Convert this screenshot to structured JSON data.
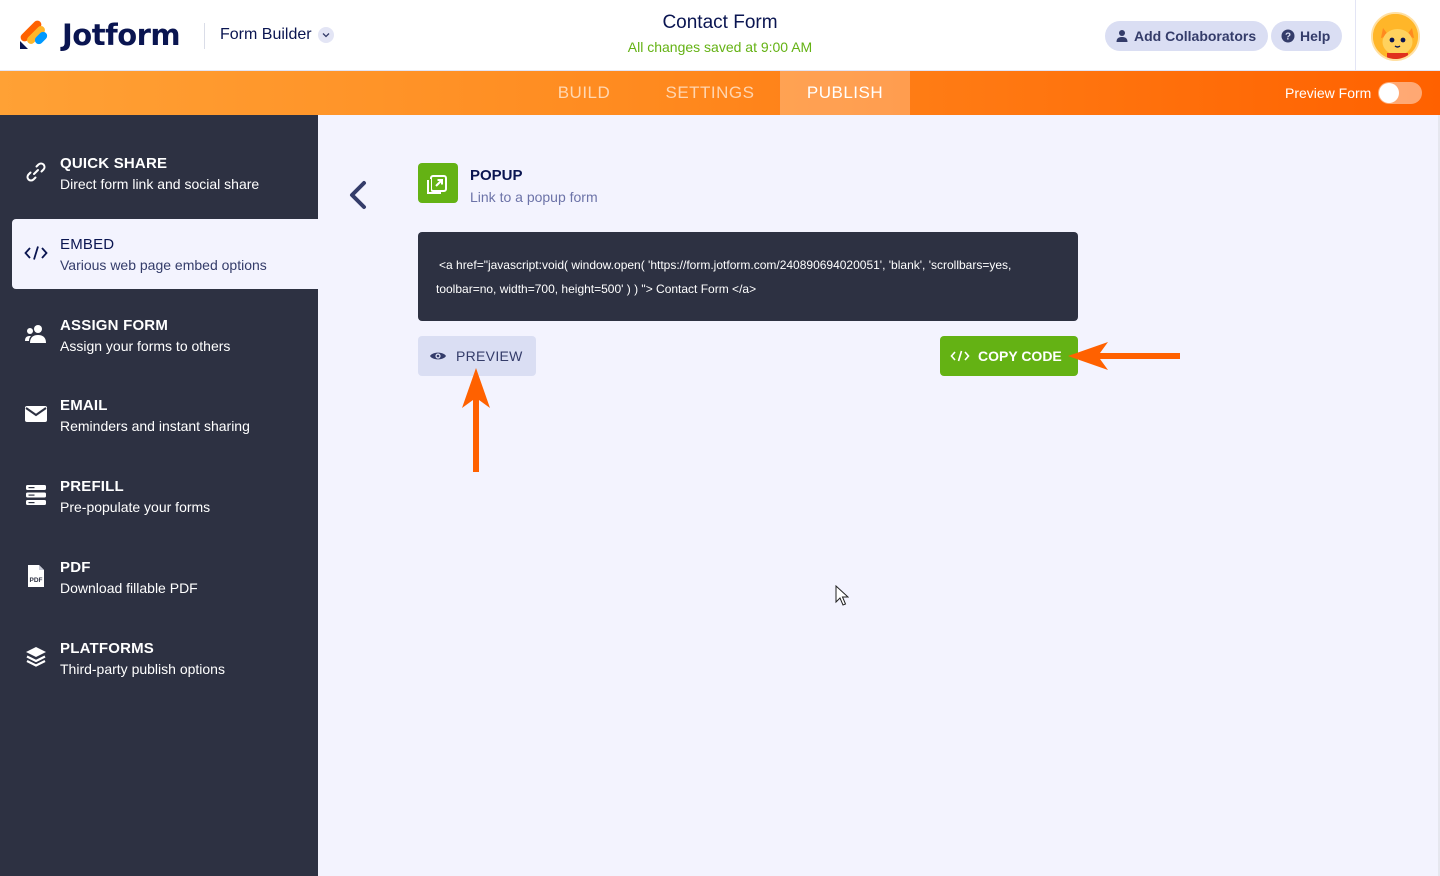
{
  "app": {
    "brand": "Jotform",
    "mode_label": "Form Builder",
    "form_title": "Contact Form",
    "save_status": "All changes saved at 9:00 AM",
    "collab_label": "Add Collaborators",
    "help_label": "Help"
  },
  "tabs": [
    {
      "label": "BUILD",
      "active": false
    },
    {
      "label": "SETTINGS",
      "active": false
    },
    {
      "label": "PUBLISH",
      "active": true
    }
  ],
  "preview_toggle": {
    "label": "Preview Form",
    "on": false
  },
  "sidebar": {
    "items": [
      {
        "title": "QUICK SHARE",
        "subtitle": "Direct form link and social share",
        "icon": "link-icon",
        "active": false
      },
      {
        "title": "EMBED",
        "subtitle": "Various web page embed options",
        "icon": "code-icon",
        "active": true
      },
      {
        "title": "ASSIGN FORM",
        "subtitle": "Assign your forms to others",
        "icon": "users-icon",
        "active": false
      },
      {
        "title": "EMAIL",
        "subtitle": "Reminders and instant sharing",
        "icon": "envelope-icon",
        "active": false
      },
      {
        "title": "PREFILL",
        "subtitle": "Pre-populate your forms",
        "icon": "prefill-icon",
        "active": false
      },
      {
        "title": "PDF",
        "subtitle": "Download fillable PDF",
        "icon": "pdf-icon",
        "active": false
      },
      {
        "title": "PLATFORMS",
        "subtitle": "Third-party publish options",
        "icon": "layers-icon",
        "active": false
      }
    ]
  },
  "embed": {
    "section_title": "POPUP",
    "section_subtitle": "Link to a popup form",
    "code_line1": "<a href=\"javascript:void( window.open( 'https://form.jotform.com/240890694020051', 'blank', 'scrollbars=yes,",
    "code_line2": "toolbar=no, width=700, height=500' ) ) \"> Contact Form </a>",
    "preview_label": "PREVIEW",
    "copy_label": "COPY CODE"
  },
  "colors": {
    "accent_orange": "#ff6100",
    "success_green": "#64b214",
    "sidebar_bg": "#2d3142",
    "main_bg": "#f3f3fe"
  }
}
